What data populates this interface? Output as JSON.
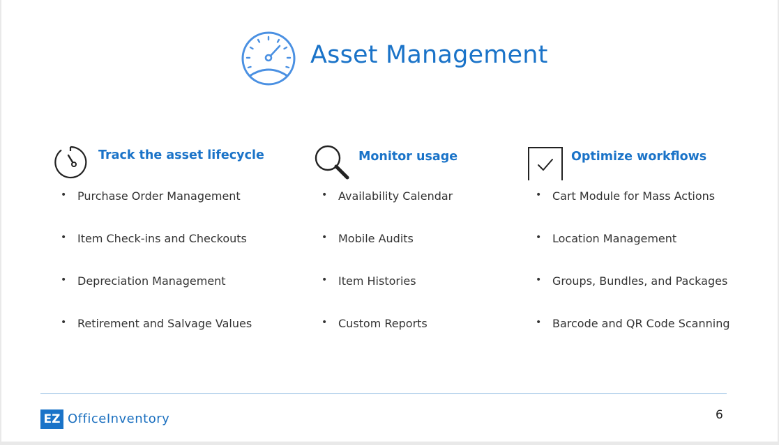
{
  "slide": {
    "title": "Asset Management",
    "title_icon": "speedometer-icon",
    "accent_color": "#1a73c8",
    "page_number": "6"
  },
  "columns": [
    {
      "icon": "stopwatch-icon",
      "title": "Track the asset lifecycle",
      "items": [
        "Purchase Order Management",
        "Item Check-ins and Checkouts",
        "Depreciation Management",
        "Retirement and Salvage Values"
      ]
    },
    {
      "icon": "magnifier-icon",
      "title": "Monitor usage",
      "items": [
        "Availability Calendar",
        "Mobile Audits",
        "Item Histories",
        "Custom Reports"
      ]
    },
    {
      "icon": "checkbox-icon",
      "title": "Optimize workflows",
      "items": [
        "Cart Module for Mass Actions",
        "Location Management",
        "Groups, Bundles, and Packages",
        "Barcode and QR Code Scanning"
      ]
    }
  ],
  "footer": {
    "logo_mark": "EZ",
    "logo_text": "OfficeInventory"
  }
}
